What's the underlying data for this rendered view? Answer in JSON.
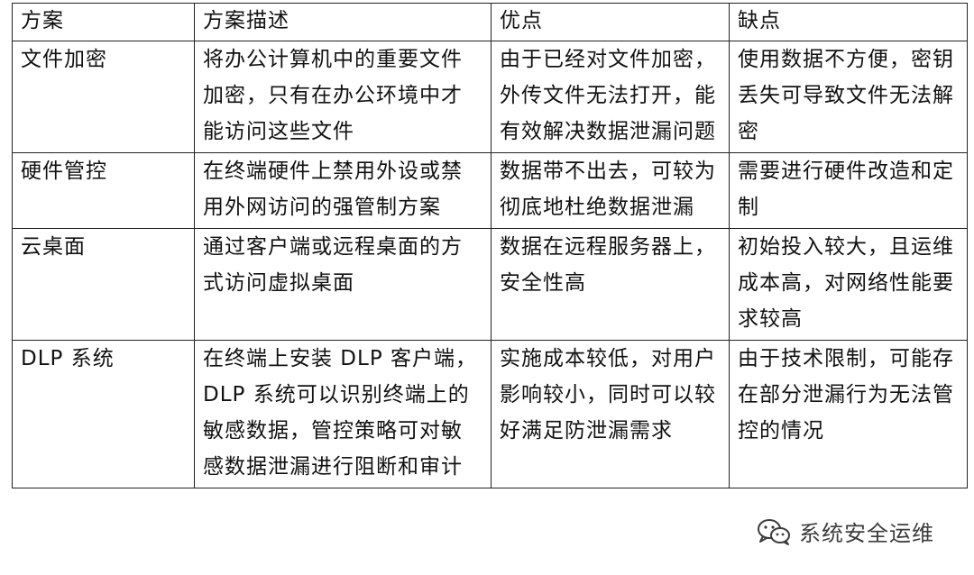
{
  "table": {
    "headers": [
      "方案",
      "方案描述",
      "优点",
      "缺点"
    ],
    "rows": [
      [
        "文件加密",
        "将办公计算机中的重要文件加密，只有在办公环境中才能访问这些文件",
        "由于已经对文件加密，外传文件无法打开，能有效解决数据泄漏问题",
        "使用数据不方便，密钥丢失可导致文件无法解密"
      ],
      [
        "硬件管控",
        "在终端硬件上禁用外设或禁用外网访问的强管制方案",
        "数据带不出去，可较为彻底地杜绝数据泄漏",
        "需要进行硬件改造和定制"
      ],
      [
        "云桌面",
        "通过客户端或远程桌面的方式访问虚拟桌面",
        "数据在远程服务器上，安全性高",
        "初始投入较大，且运维成本高，对网络性能要求较高"
      ],
      [
        "DLP 系统",
        "在终端上安装 DLP 客户端，DLP 系统可以识别终端上的敏感数据，管控策略可对敏感数据泄漏进行阻断和审计",
        "实施成本较低，对用户影响较小，同时可以较好满足防泄漏需求",
        "由于技术限制，可能存在部分泄漏行为无法管控的情况"
      ]
    ]
  },
  "watermark": {
    "icon": "wechat-icon",
    "text": "系统安全运维"
  }
}
